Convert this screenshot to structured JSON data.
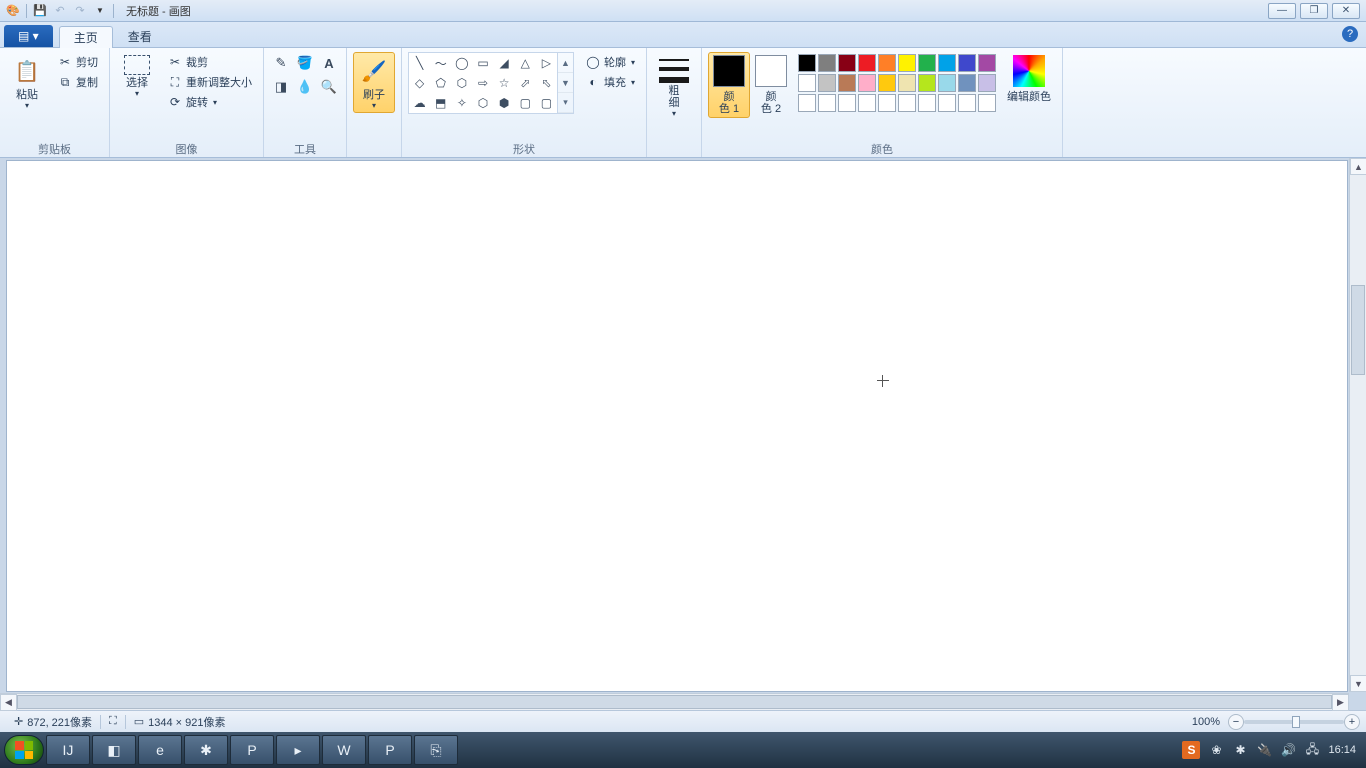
{
  "title": "无标题 - 画图",
  "tabs": {
    "file": "▤ ▾",
    "home": "主页",
    "view": "查看"
  },
  "help_glyph": "?",
  "window_controls": {
    "min": "—",
    "max": "❐",
    "close": "✕"
  },
  "groups": {
    "clipboard": {
      "label": "剪贴板",
      "paste": "粘贴",
      "cut": "剪切",
      "copy": "复制"
    },
    "image": {
      "label": "图像",
      "select": "选择",
      "crop": "裁剪",
      "resize": "重新调整大小",
      "rotate": "旋转"
    },
    "tools": {
      "label": "工具"
    },
    "brushes": {
      "label": "刷子"
    },
    "shapes": {
      "label": "形状",
      "outline": "轮廓",
      "fill": "填充"
    },
    "size": {
      "label": "粗\n细"
    },
    "colors": {
      "label": "颜色",
      "color1": "颜\n色 1",
      "color2": "颜\n色 2",
      "edit": "编辑颜色",
      "color1_value": "#000000",
      "color2_value": "#ffffff",
      "palette_row1": [
        "#000000",
        "#7f7f7f",
        "#880015",
        "#ed1c24",
        "#ff7f27",
        "#fff200",
        "#22b14c",
        "#00a2e8",
        "#3f48cc",
        "#a349a4"
      ],
      "palette_row2": [
        "#ffffff",
        "#c3c3c3",
        "#b97a57",
        "#ffaec9",
        "#ffc90e",
        "#efe4b0",
        "#b5e61d",
        "#99d9ea",
        "#7092be",
        "#c8bfe7"
      ],
      "palette_row3": [
        "#ffffff",
        "#ffffff",
        "#ffffff",
        "#ffffff",
        "#ffffff",
        "#ffffff",
        "#ffffff",
        "#ffffff",
        "#ffffff",
        "#ffffff"
      ]
    }
  },
  "shapes_glyphs": [
    "╲",
    "〜",
    "◯",
    "▭",
    "◢",
    "△",
    "▷",
    "◇",
    "⬠",
    "⬡",
    "⇨",
    "☆",
    "⬀",
    "⬁",
    "☁",
    "⬒",
    "✧",
    "⬡",
    "⬢",
    "▢",
    "▢"
  ],
  "status": {
    "pos": "872, 221像素",
    "sel_icon": "⛶",
    "size": "1344 × 921像素",
    "zoom": "100%"
  },
  "taskbar": {
    "icons": [
      "IJ",
      "◧",
      "e",
      "✱",
      "P",
      "▸",
      "W",
      "P",
      "⎘"
    ],
    "time": "16:14",
    "sogou": "S"
  }
}
